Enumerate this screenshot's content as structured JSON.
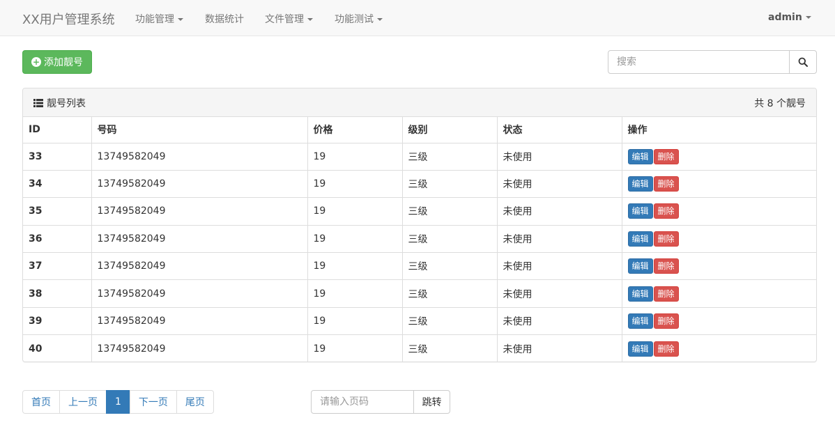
{
  "navbar": {
    "brand": "XX用户管理系统",
    "items": [
      {
        "label": "功能管理",
        "dropdown": true
      },
      {
        "label": "数据统计",
        "dropdown": false
      },
      {
        "label": "文件管理",
        "dropdown": true
      },
      {
        "label": "功能测试",
        "dropdown": true
      }
    ],
    "user": "admin"
  },
  "toolbar": {
    "add_label": "添加靓号",
    "search_placeholder": "搜索"
  },
  "panel": {
    "title": "靓号列表",
    "count_text": "共 8 个靓号"
  },
  "table": {
    "columns": [
      "ID",
      "号码",
      "价格",
      "级别",
      "状态",
      "操作"
    ],
    "rows": [
      {
        "id": "33",
        "number": "13749582049",
        "price": "19",
        "level": "三级",
        "status": "未使用"
      },
      {
        "id": "34",
        "number": "13749582049",
        "price": "19",
        "level": "三级",
        "status": "未使用"
      },
      {
        "id": "35",
        "number": "13749582049",
        "price": "19",
        "level": "三级",
        "status": "未使用"
      },
      {
        "id": "36",
        "number": "13749582049",
        "price": "19",
        "level": "三级",
        "status": "未使用"
      },
      {
        "id": "37",
        "number": "13749582049",
        "price": "19",
        "level": "三级",
        "status": "未使用"
      },
      {
        "id": "38",
        "number": "13749582049",
        "price": "19",
        "level": "三级",
        "status": "未使用"
      },
      {
        "id": "39",
        "number": "13749582049",
        "price": "19",
        "level": "三级",
        "status": "未使用"
      },
      {
        "id": "40",
        "number": "13749582049",
        "price": "19",
        "level": "三级",
        "status": "未使用"
      }
    ],
    "edit_label": "编辑",
    "delete_label": "删除"
  },
  "pagination": {
    "first": "首页",
    "prev": "上一页",
    "current": "1",
    "next": "下一页",
    "last": "尾页"
  },
  "jump": {
    "placeholder": "请输入页码",
    "button": "跳转"
  },
  "colors": {
    "success": "#5cb85c",
    "primary": "#337ab7",
    "danger": "#d9534f"
  }
}
